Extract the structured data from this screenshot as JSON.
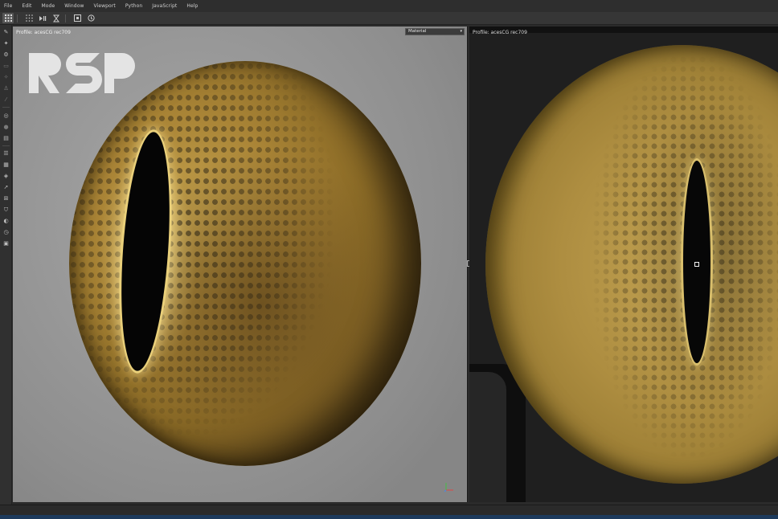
{
  "menu": {
    "items": [
      "File",
      "Edit",
      "Mode",
      "Window",
      "Viewport",
      "Python",
      "JavaScript",
      "Help"
    ]
  },
  "toolbar": {
    "icons": [
      "grid-icon",
      "dots-grid-icon",
      "step-icon",
      "hourglass-icon",
      "frame-icon",
      "history-icon"
    ]
  },
  "left_tools": {
    "icons": [
      "brush-icon",
      "pin-icon",
      "gear-icon",
      "screen-icon",
      "pin-icon",
      "stamp-icon",
      "dropper-icon",
      "target-icon",
      "circle-icon",
      "document-icon",
      "layers-icon",
      "layers-icon",
      "layers-stack-icon",
      "rocket-icon",
      "grid-icon",
      "shield-icon",
      "globe-icon",
      "clock-icon",
      "panel-icon"
    ]
  },
  "viewport_left": {
    "profile": "Profile: acesCG rec709",
    "material_select": "Material",
    "logo": "RSP"
  },
  "viewport_right": {
    "profile": "Profile: acesCG rec709"
  },
  "colors": {
    "menubar": "#2e2e2e",
    "toolbar": "#363636",
    "left_bg": "#999999",
    "right_bg": "#1f1f1f",
    "iris": "#a98436",
    "status_accent": "#1d3a5c"
  }
}
